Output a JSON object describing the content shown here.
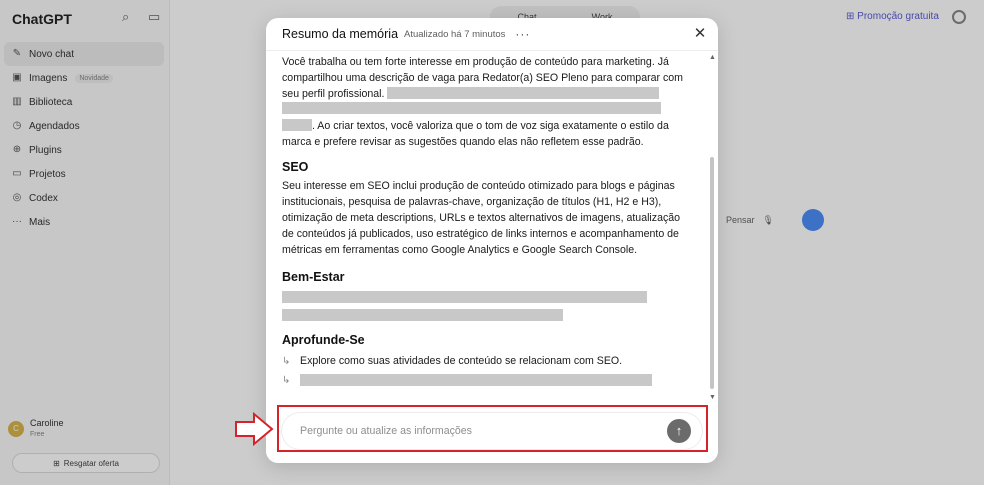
{
  "app": {
    "brand": "ChatGPT",
    "sidebar": {
      "items": [
        {
          "label": "Novo chat",
          "icon": "edit-icon"
        },
        {
          "label": "Imagens",
          "icon": "image-icon",
          "tag": "Novidade"
        },
        {
          "label": "Biblioteca",
          "icon": "library-icon"
        },
        {
          "label": "Agendados",
          "icon": "clock-icon"
        },
        {
          "label": "Plugins",
          "icon": "plugin-icon"
        },
        {
          "label": "Projetos",
          "icon": "folder-icon"
        },
        {
          "label": "Codex",
          "icon": "codex-icon"
        },
        {
          "label": "Mais",
          "icon": "more-icon"
        }
      ],
      "user_name": "Caroline",
      "user_plan": "Free",
      "user_initial": "C",
      "offer_button": "Resgatar oferta"
    },
    "top": {
      "tab_chat": "Chat",
      "tab_work": "Work",
      "promo": "Promoção gratuita"
    },
    "composer_bg_placeholder": "Pensar"
  },
  "modal": {
    "title": "Resumo da memória",
    "updated": "Atualizado há 7 minutos",
    "more": "···",
    "close": "✕",
    "intro_text": "Você trabalha ou tem forte interesse em produção de conteúdo para marketing. Já compartilhou uma descrição de vaga para Redator(a) SEO Pleno para comparar com seu perfil profissional.",
    "intro_tail": ". Ao criar textos, você valoriza que o tom de voz siga exatamente o estilo da marca e prefere revisar as sugestões quando elas não refletem esse padrão.",
    "sections": {
      "seo_title": "SEO",
      "seo_text": "Seu interesse em SEO inclui produção de conteúdo otimizado para blogs e páginas institucionais, pesquisa de palavras-chave, organização de títulos (H1, H2 e H3), otimização de meta descriptions, URLs e textos alternativos de imagens, atualização de conteúdos já publicados, uso estratégico de links internos e acompanhamento de métricas em ferramentas como Google Analytics e Google Search Console.",
      "wellbeing_title": "Bem-Estar",
      "deepen_title": "Aprofunde-Se",
      "suggestion_1": "Explore como suas atividades de conteúdo se relacionam com SEO."
    },
    "composer_placeholder": "Pergunte ou atualize as informações",
    "send_icon": "↑"
  },
  "colors": {
    "highlight": "#d6232a",
    "redaction": "#c8c8c8",
    "send_button": "#6b6b6b"
  }
}
